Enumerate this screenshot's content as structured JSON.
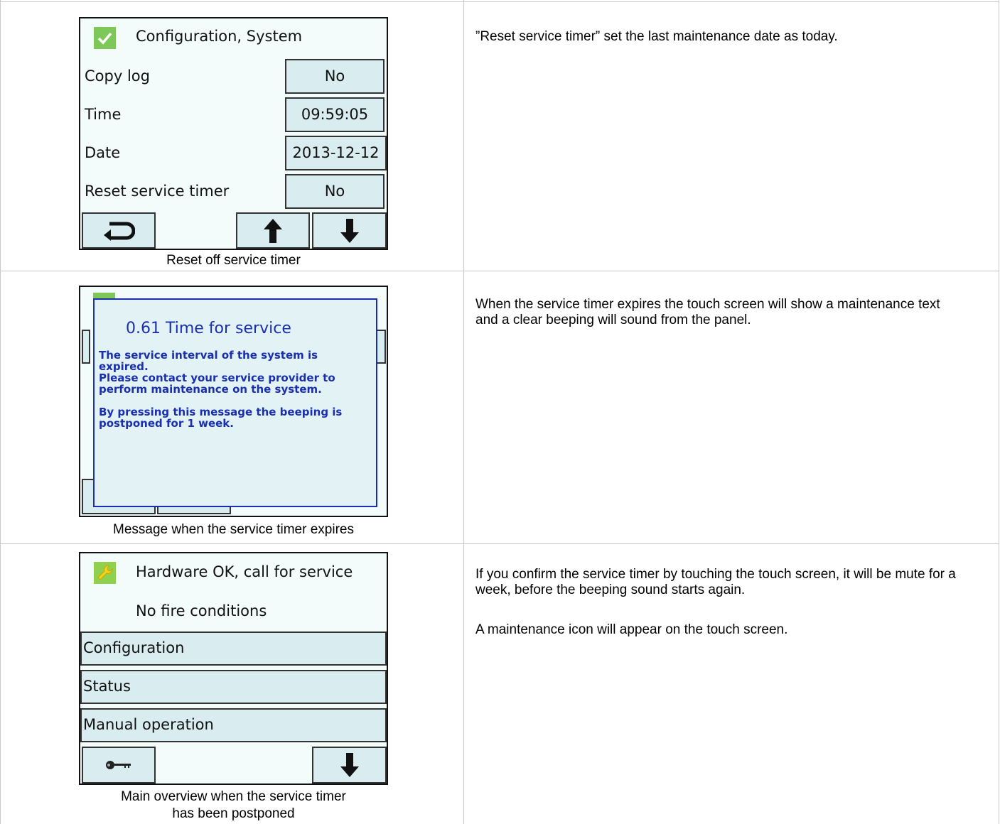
{
  "row1": {
    "screen": {
      "title": "Configuration, System",
      "rows": [
        {
          "label": "Copy log",
          "value": "No"
        },
        {
          "label": "Time",
          "value": "09:59:05"
        },
        {
          "label": "Date",
          "value": "2013-12-12"
        },
        {
          "label": "Reset service timer",
          "value": "No"
        }
      ],
      "buttons": [
        "return-icon",
        "arrow-up-icon",
        "arrow-down-icon"
      ],
      "status_icon": "checkmark-icon",
      "status_color": "#7ec85a"
    },
    "caption": "Reset off service timer",
    "description": "”Reset service timer” set the last maintenance date as today."
  },
  "row2": {
    "dialog": {
      "title": "0.61 Time for service",
      "body": "The service interval of the system is\nexpired.\nPlease contact your service provider to\nperform maintenance on the system.\n\nBy pressing this message the beeping is\npostponed for 1 week.",
      "color": "#1a2fb0"
    },
    "caption": "Message when the service timer expires",
    "description": "When the service timer expires the touch screen will show a maintenance text and a clear beeping will sound from the panel."
  },
  "row3": {
    "screen": {
      "title": "Hardware OK, call for service",
      "subtitle": "No fire conditions",
      "menu": [
        "Configuration",
        "Status",
        "Manual operation"
      ],
      "buttons": [
        "key-icon",
        "arrow-down-icon"
      ],
      "status_icon": "wrench-icon",
      "status_color": "#8fd14f"
    },
    "caption": [
      "Main overview when the service timer",
      "has been postponed"
    ],
    "description": [
      "If you confirm the service timer by touching the touch screen, it will be mute for a week, before the beeping sound starts again.",
      "A maintenance icon will appear on the touch screen."
    ]
  }
}
